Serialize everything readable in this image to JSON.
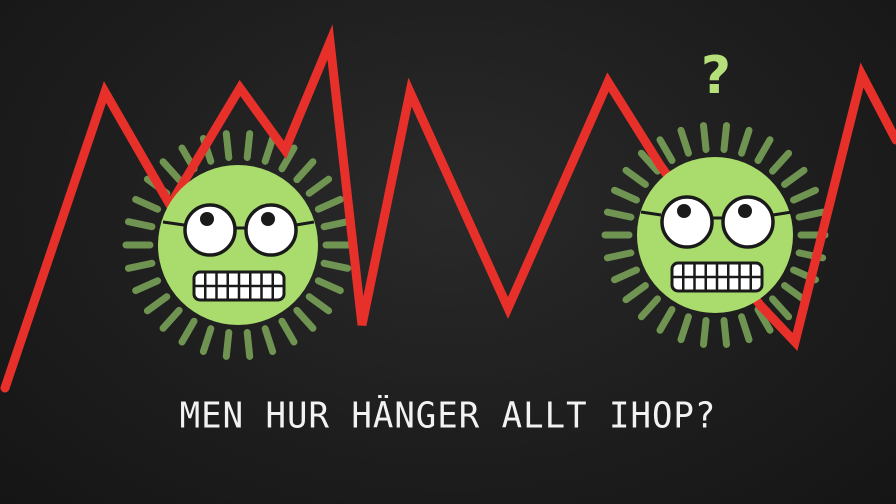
{
  "caption": "MEN HUR HÄNGER ALLT IHOP?",
  "question_mark": "?",
  "colors": {
    "background": "#1b1b1b",
    "line": "#e8302a",
    "virus_body": "#a9dc6d",
    "virus_spikes": "#7ea85a",
    "caption": "#f2f2f2",
    "question_mark": "#b6e07a"
  },
  "icons": [
    "virus-character-icon",
    "virus-character-icon",
    "question-mark-icon"
  ]
}
